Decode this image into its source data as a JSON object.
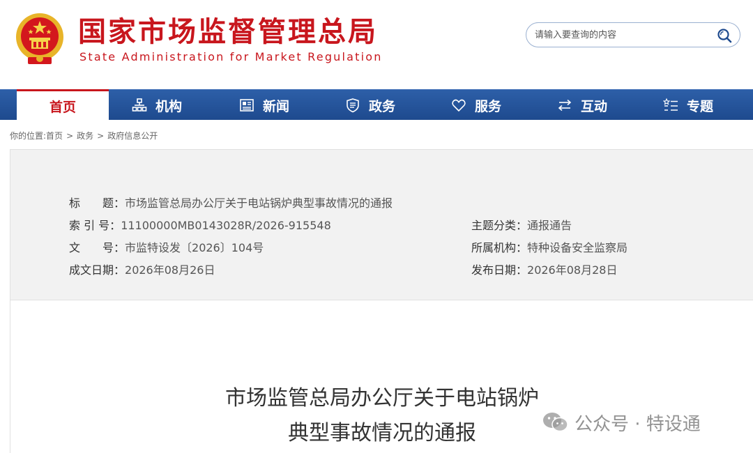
{
  "header": {
    "site_name_cn": "国家市场监督管理总局",
    "site_name_en": "State Administration for Market Regulation",
    "search_placeholder": "请输入要查询的内容"
  },
  "nav": {
    "items": [
      {
        "label": "首页",
        "icon": "none",
        "active": true
      },
      {
        "label": "机构",
        "icon": "org-chart-icon"
      },
      {
        "label": "新闻",
        "icon": "newspaper-icon"
      },
      {
        "label": "政务",
        "icon": "shield-book-icon"
      },
      {
        "label": "服务",
        "icon": "heart-icon"
      },
      {
        "label": "互动",
        "icon": "exchange-arrows-icon"
      },
      {
        "label": "专题",
        "icon": "star-list-icon"
      }
    ]
  },
  "breadcrumb": {
    "prefix": "你的位置:",
    "items": [
      "首页",
      "政务",
      "政府信息公开"
    ],
    "separator": ">"
  },
  "meta": {
    "title_label": "标　　题：",
    "title_value": "市场监管总局办公厅关于电站锅炉典型事故情况的通报",
    "index_label": "索 引 号：",
    "index_value": "11100000MB0143028R/2026-915548",
    "doc_no_label": "文　　号：",
    "doc_no_value": "市监特设发〔2026〕104号",
    "date_written_label": "成文日期：",
    "date_written_value": "2026年08月26日",
    "topic_label": "主题分类：",
    "topic_value": "通报通告",
    "agency_label": "所属机构：",
    "agency_value": "特种设备安全监察局",
    "publish_label": "发布日期：",
    "publish_value": "2026年08月28日"
  },
  "document": {
    "title_line1": "市场监管总局办公厅关于电站锅炉",
    "title_line2": "典型事故情况的通报"
  },
  "watermark": {
    "text": "公众号 · 特设通"
  },
  "colors": {
    "brand_red": "#c8161d",
    "nav_blue": "#1e4a8e",
    "meta_bg": "#f2f2f2"
  }
}
